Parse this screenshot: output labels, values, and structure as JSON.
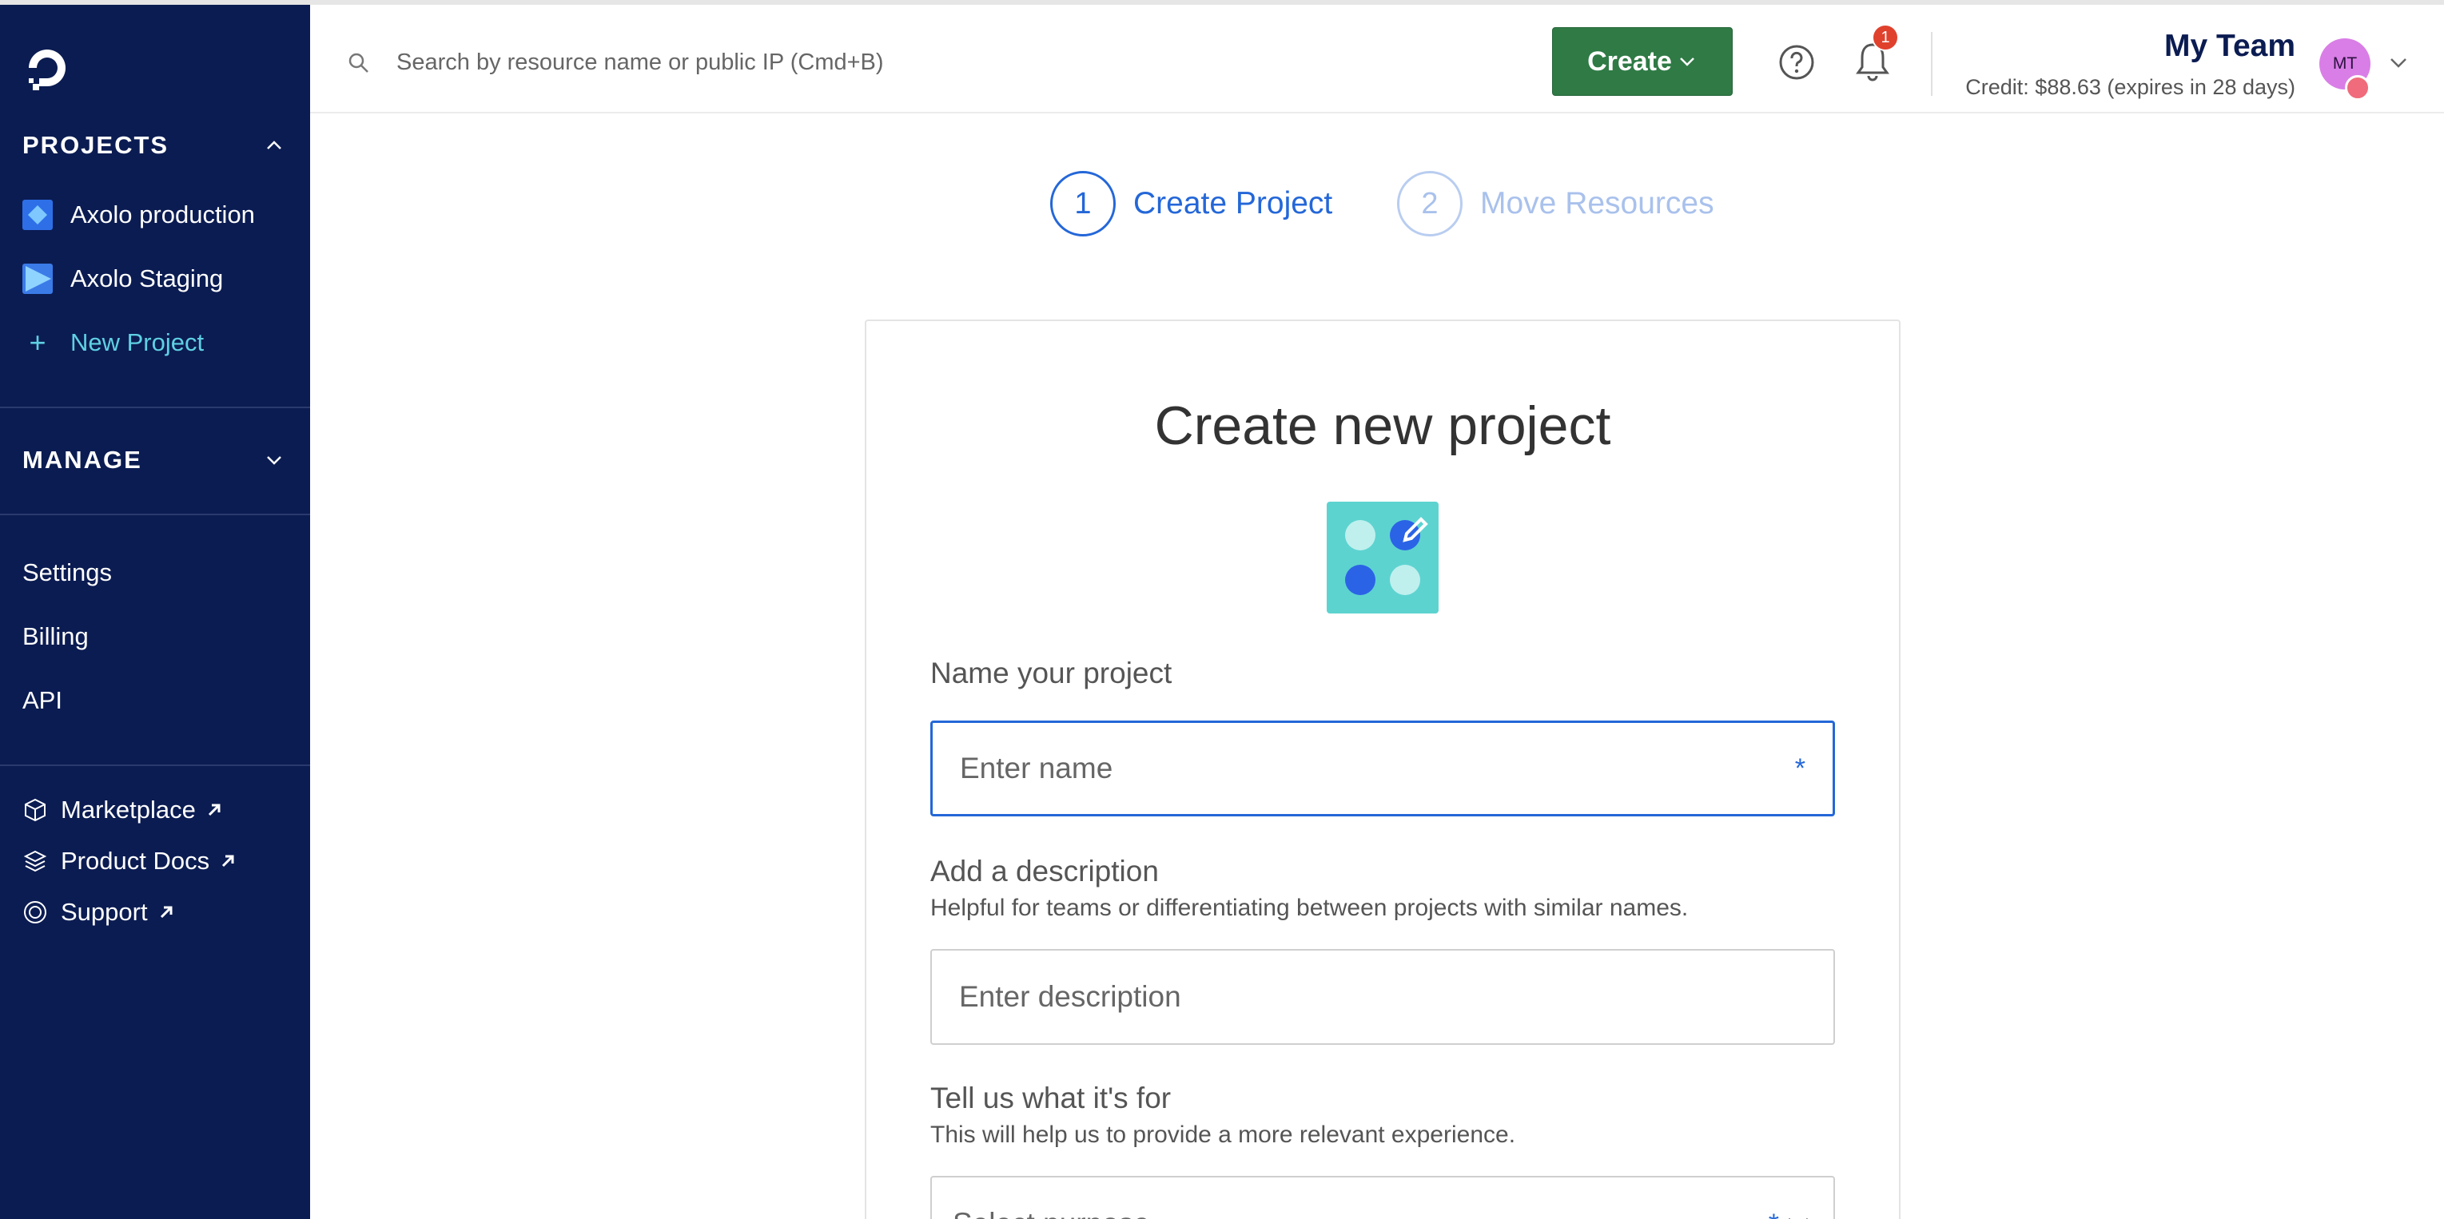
{
  "sidebar": {
    "projects_heading": "PROJECTS",
    "projects": [
      {
        "label": "Axolo production",
        "icon": "diamond-icon"
      },
      {
        "label": "Axolo Staging",
        "icon": "triangle-icon"
      }
    ],
    "new_project_label": "New Project",
    "manage_heading": "MANAGE",
    "nav": [
      {
        "label": "Settings"
      },
      {
        "label": "Billing"
      },
      {
        "label": "API"
      }
    ],
    "external": [
      {
        "label": "Marketplace",
        "icon": "cube-icon"
      },
      {
        "label": "Product Docs",
        "icon": "layers-icon"
      },
      {
        "label": "Support",
        "icon": "lifebuoy-icon"
      }
    ]
  },
  "topbar": {
    "search_placeholder": "Search by resource name or public IP (Cmd+B)",
    "create_label": "Create",
    "notification_count": "1",
    "team_name": "My Team",
    "credit": "Credit: $88.63 (expires in 28 days)",
    "avatar_initials": "MT"
  },
  "stepper": [
    {
      "number": "1",
      "label": "Create Project",
      "state": "active"
    },
    {
      "number": "2",
      "label": "Move Resources",
      "state": "inactive"
    }
  ],
  "form": {
    "title": "Create new project",
    "name_label": "Name your project",
    "name_placeholder": "Enter name",
    "name_value": "",
    "required_mark": "*",
    "description_label": "Add a description",
    "description_help": "Helpful for teams or differentiating between projects with similar names.",
    "description_placeholder": "Enter description",
    "description_value": "",
    "purpose_label": "Tell us what it's for",
    "purpose_help": "This will help us to provide a more relevant experience.",
    "purpose_placeholder": "Select purpose"
  },
  "colors": {
    "sidebar_bg": "#0b1c52",
    "accent_blue": "#2467d8",
    "create_green": "#2f7a45",
    "new_project_cyan": "#5fd0e3",
    "badge_red": "#e0412d"
  }
}
